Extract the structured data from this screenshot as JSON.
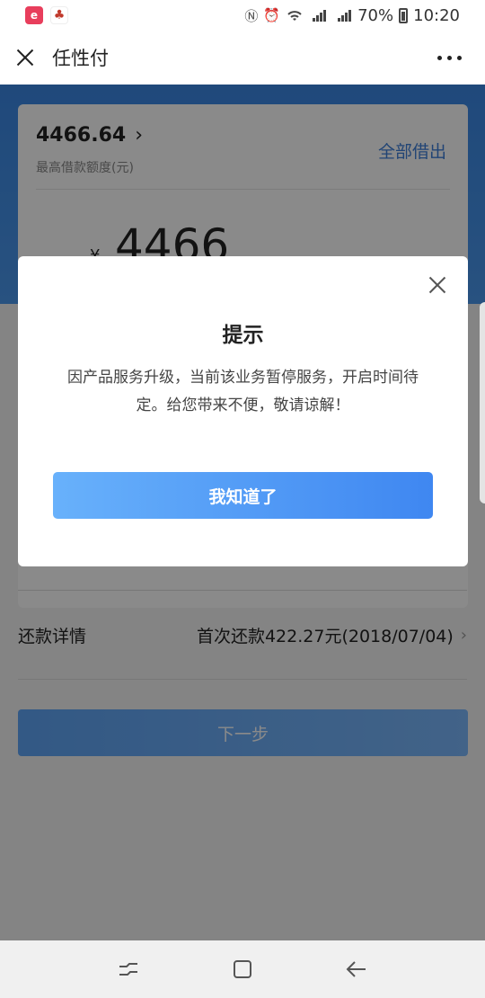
{
  "statusbar": {
    "battery": "70%",
    "time": "10:20",
    "icons": [
      "nfc-icon",
      "alarm-icon",
      "wifi-icon",
      "signal-4g-icon",
      "signal-2g-icon",
      "battery-icon"
    ]
  },
  "titlebar": {
    "title": "任性付"
  },
  "card": {
    "max_amount": "4466.64",
    "max_amount_label": "最高借款额度(元)",
    "borrow_all": "全部借出",
    "currency_symbol": "¥",
    "amount": "4466"
  },
  "repay": {
    "label": "还款详情",
    "value": "首次还款422.27元(2018/07/04)"
  },
  "next_button": "下一步",
  "dialog": {
    "title": "提示",
    "message": "因产品服务升级，当前该业务暂停服务，开启时间待定。给您带来不便，敬请谅解！",
    "confirm": "我知道了"
  },
  "colors": {
    "brand_blue": "#3b87e4",
    "link_blue": "#3d7fd8"
  }
}
